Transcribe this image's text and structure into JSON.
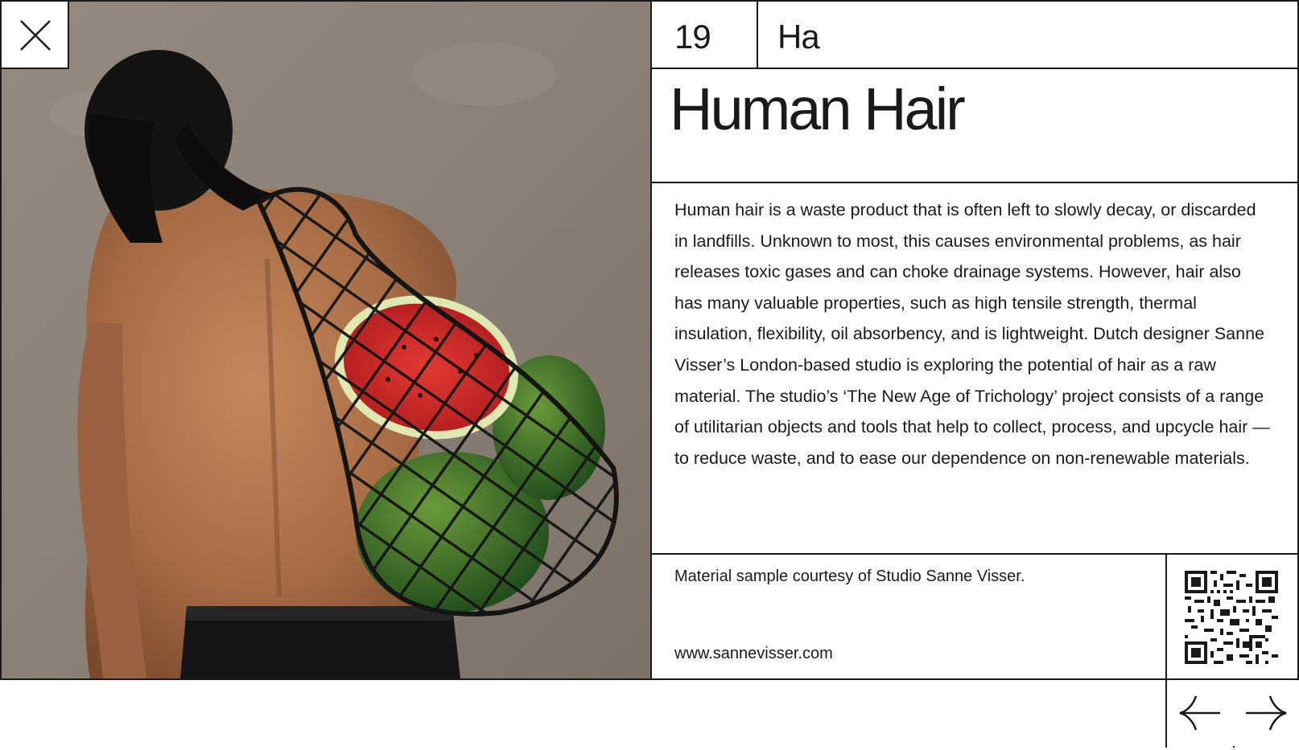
{
  "header": {
    "number": "19",
    "symbol": "Ha",
    "title": "Human Hair"
  },
  "description": "Human hair is a waste product that is often left to slowly decay, or discarded in landfills. Unknown to most, this causes environmental problems, as hair releases toxic gases and can choke drainage systems. However, hair also has many valuable properties, such as high tensile strength, thermal insulation, flexibility, oil absorbency, and is lightweight. Dutch designer Sanne Visser’s London-based studio is exploring the potential of hair as a raw material. The studio’s ‘The New Age of Trichology’ project consists of a range of utilitarian objects and tools that help to collect, process, and upcycle hair — to reduce waste, and to ease our dependence on non-renewable materials.",
  "footer": {
    "credit": "Material sample courtesy of Studio Sanne Visser.",
    "website": "www.sannevisser.com"
  },
  "icons": {
    "close": "close-icon",
    "prev": "arrow-left-icon",
    "next": "arrow-right-icon",
    "qr": "qr-code-icon"
  },
  "colors": {
    "line": "#1a1a1a",
    "background": "#ffffff"
  }
}
